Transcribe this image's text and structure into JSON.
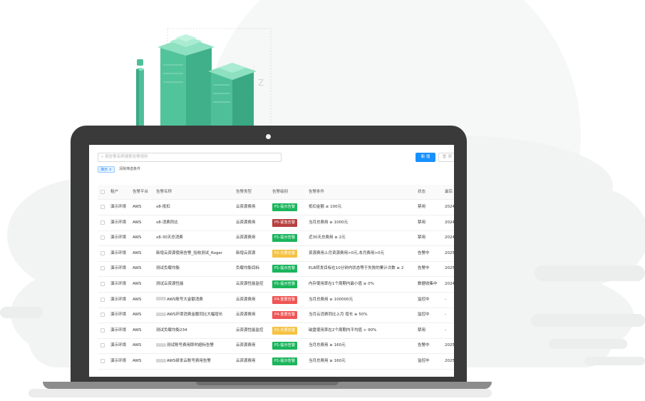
{
  "colors": {
    "accent": "#1890ff",
    "p1": "#1bb55c",
    "p2": "#f5c242",
    "p4": "#f05454",
    "p5": "#b84040",
    "illustration_green": "#4fbf9a",
    "cloud": "#f2f4f3"
  },
  "illustration": {
    "axis_label": "Z"
  },
  "toolbar": {
    "search_placeholder": "按告警名称搜索告警规则",
    "search_icon": "search-icon",
    "new_label": "新 增",
    "delete_label": "删",
    "delete_icon": "trash-icon"
  },
  "filter": {
    "tag_label": "演示",
    "tag_close": "×",
    "clear_label": "清除筛选条件"
  },
  "table": {
    "headers": [
      "租户",
      "告警平台",
      "告警名称",
      "告警类型",
      "告警级别",
      "告警条件",
      "状态",
      "最后"
    ],
    "rows": [
      {
        "tenant": "演示环境",
        "platform": "AWS",
        "blur": false,
        "name": "x8-抵扣",
        "type": "云资源费用",
        "level": "P1-提示告警",
        "levelKey": "p1",
        "condition": "抵扣金额 ≥ 100元",
        "status": "禁用",
        "last": "2024"
      },
      {
        "tenant": "演示环境",
        "platform": "AWS",
        "blur": false,
        "name": "x8-消费同比",
        "type": "云资源费用",
        "level": "P5-紧急告警",
        "levelKey": "p5",
        "condition": "当月总费用 ≥ 1000元",
        "status": "禁用",
        "last": "2024"
      },
      {
        "tenant": "演示环境",
        "platform": "AWS",
        "blur": false,
        "name": "x8-30天总消费",
        "type": "云资源费用",
        "level": "P1-提示告警",
        "levelKey": "p1",
        "condition": "近30天总费用 ≥ 2元",
        "status": "禁用",
        "last": "2024"
      },
      {
        "tenant": "演示环境",
        "platform": "AWS",
        "blur": false,
        "name": "新增云资源使用告警_验收测试_Roger",
        "type": "新增云资源",
        "level": "P2-次要告警",
        "levelKey": "p2",
        "condition": "资源费用上月资源费用>0元,本月费用>0元",
        "status": "告警中",
        "last": "2025"
      },
      {
        "tenant": "演示环境",
        "platform": "AWS",
        "blur": false,
        "name": "测试负载均衡",
        "type": "负载均衡目标",
        "level": "P1-提示告警",
        "levelKey": "p1",
        "condition": "ELB转发目标在10分钟内状态等于失败的累计次数 ≥ 2",
        "status": "告警中",
        "last": "2025"
      },
      {
        "tenant": "演示环境",
        "platform": "AWS",
        "blur": false,
        "name": "测试云资源性能",
        "type": "云资源性能监控",
        "level": "P1-提示告警",
        "levelKey": "p1",
        "condition": "内存使用率在1个周期内最小值 ≥ 0%",
        "status": "数据收集中",
        "last": "2024"
      },
      {
        "tenant": "演示环境",
        "platform": "AWS",
        "blur": true,
        "name": "AWS账号大金额消费",
        "type": "云资源费用",
        "level": "P4-重要告警",
        "levelKey": "p4",
        "condition": "当月总费用 ≥ 100000元",
        "status": "监控中",
        "last": "-"
      },
      {
        "tenant": "演示环境",
        "platform": "AWS",
        "blur": true,
        "name": "AWS环境消费金额同比大幅增长",
        "type": "云资源费用",
        "level": "P4-重要告警",
        "levelKey": "p4",
        "condition": "当月云消费同比上月 增长 ≥ 50%",
        "status": "监控中",
        "last": "-"
      },
      {
        "tenant": "演示环境",
        "platform": "AWS",
        "blur": false,
        "name": "测试负载均衡234",
        "type": "云资源性能监控",
        "level": "P2-次要告警",
        "levelKey": "p2",
        "condition": "磁盘使用率在2个周期内平均值 > 90%",
        "status": "禁用",
        "last": "-"
      },
      {
        "tenant": "演示环境",
        "platform": "AWS",
        "blur": true,
        "name": "测试账号费用即时超标告警",
        "type": "云资源费用",
        "level": "P1-提示告警",
        "levelKey": "p1",
        "condition": "当月总费用 ≥ 160元",
        "status": "告警中",
        "last": "2025"
      },
      {
        "tenant": "演示环境",
        "platform": "AWS",
        "blur": true,
        "name": "AWS研发云账号费用告警",
        "type": "云资源费用",
        "level": "P1-提示告警",
        "levelKey": "p1",
        "condition": "当月总费用 ≥ 160元",
        "status": "监控中",
        "last": "2025"
      }
    ]
  }
}
